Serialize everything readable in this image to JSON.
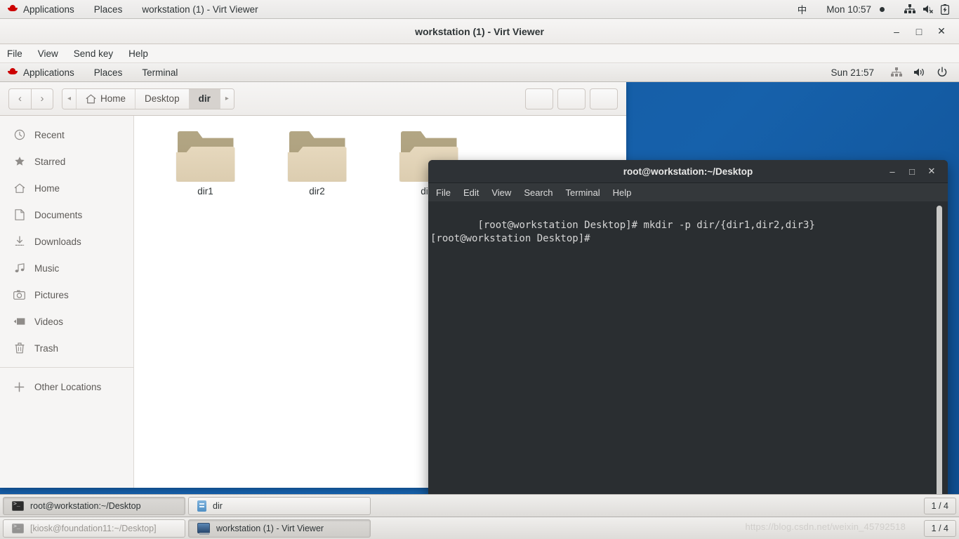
{
  "host_topbar": {
    "items": [
      {
        "label": "Applications",
        "icon": "redhat-logo"
      },
      {
        "label": "Places",
        "icon": ""
      },
      {
        "label": "workstation (1) - Virt Viewer",
        "icon": ""
      }
    ],
    "input_method": "中",
    "clock": "Mon 10:57",
    "icons": [
      "network-icon",
      "volume-muted-icon",
      "battery-charging-icon"
    ]
  },
  "virt_viewer": {
    "title": "workstation (1) - Virt Viewer",
    "menus": [
      "File",
      "View",
      "Send key",
      "Help"
    ],
    "window_buttons": {
      "minimize": "–",
      "maximize": "□",
      "close": "✕"
    }
  },
  "guest_topbar": {
    "items": [
      {
        "label": "Applications",
        "icon": "redhat-logo"
      },
      {
        "label": "Places",
        "icon": ""
      },
      {
        "label": "Terminal",
        "icon": ""
      }
    ],
    "clock": "Sun 21:57",
    "icons": [
      "network-icon",
      "volume-icon",
      "power-icon"
    ]
  },
  "nautilus": {
    "nav": {
      "back": "‹",
      "forward": "›"
    },
    "breadcrumbs": [
      {
        "label": "◂",
        "type": "arrow"
      },
      {
        "label": "Home",
        "icon": "home-icon",
        "type": "crumb"
      },
      {
        "label": "Desktop",
        "type": "crumb"
      },
      {
        "label": "dir",
        "type": "crumb",
        "active": true
      },
      {
        "label": "▸",
        "type": "arrow"
      }
    ],
    "sidebar": [
      {
        "label": "Recent",
        "icon": "clock-icon"
      },
      {
        "label": "Starred",
        "icon": "star-icon"
      },
      {
        "label": "Home",
        "icon": "home-icon"
      },
      {
        "label": "Documents",
        "icon": "document-icon"
      },
      {
        "label": "Downloads",
        "icon": "download-icon"
      },
      {
        "label": "Music",
        "icon": "music-icon"
      },
      {
        "label": "Pictures",
        "icon": "camera-icon"
      },
      {
        "label": "Videos",
        "icon": "video-icon"
      },
      {
        "label": "Trash",
        "icon": "trash-icon"
      },
      {
        "label": "Other Locations",
        "icon": "plus-icon",
        "separated": true
      }
    ],
    "files": [
      {
        "name": "dir1",
        "icon": "folder-icon"
      },
      {
        "name": "dir2",
        "icon": "folder-icon"
      },
      {
        "name": "dir3",
        "icon": "folder-icon"
      }
    ]
  },
  "terminal": {
    "title": "root@workstation:~/Desktop",
    "menus": [
      "File",
      "Edit",
      "View",
      "Search",
      "Terminal",
      "Help"
    ],
    "window_buttons": {
      "minimize": "–",
      "maximize": "□",
      "close": "✕"
    },
    "lines": [
      "[root@workstation Desktop]# mkdir -p dir/{dir1,dir2,dir3}",
      "[root@workstation Desktop]#"
    ],
    "content": "[root@workstation Desktop]# mkdir -p dir/{dir1,dir2,dir3}\n[root@workstation Desktop]#"
  },
  "guest_taskbar": {
    "tasks": [
      {
        "label": "root@workstation:~/Desktop",
        "icon": "terminal-icon",
        "active": true
      },
      {
        "label": "dir",
        "icon": "drive-icon",
        "active": false
      }
    ],
    "workspace": "1 / 4"
  },
  "host_taskbar": {
    "tasks": [
      {
        "label": "[kiosk@foundation11:~/Desktop]",
        "icon": "terminal-icon",
        "active": false
      },
      {
        "label": "workstation (1) - Virt Viewer",
        "icon": "virt-viewer-icon",
        "active": true
      }
    ],
    "workspace": "1 / 4"
  },
  "watermark": "https://blog.csdn.net/weixin_45792518",
  "colors": {
    "desktop_blue": "#1662a8",
    "terminal_bg": "#2a2e31",
    "folder_tan": "#dccdb0",
    "redhat_red": "#cc0000"
  }
}
